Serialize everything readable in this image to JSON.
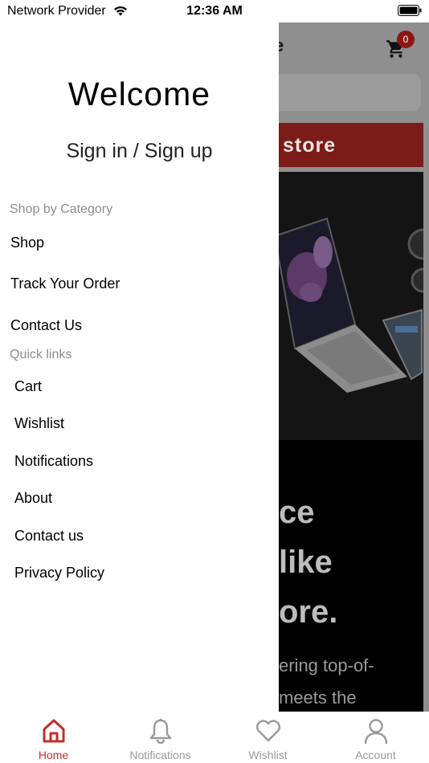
{
  "status_bar": {
    "carrier": "Network Provider",
    "time": "12:36 AM"
  },
  "background_page": {
    "header_title_fragment": "e",
    "cart_count": "0",
    "banner_text": "store",
    "hero_lines": [
      "ce",
      " like",
      "ore."
    ],
    "hero_sub_lines": [
      "ering top-of-",
      "meets the"
    ]
  },
  "drawer": {
    "welcome": "Welcome",
    "signin": "Sign in / Sign up",
    "sections": [
      {
        "title": "Shop by Category",
        "items": [
          "Shop",
          "Track Your Order",
          "Contact Us"
        ]
      },
      {
        "title": "Quick links",
        "items": [
          "Cart",
          "Wishlist",
          "Notifications",
          "About",
          "Contact us",
          "Privacy Policy"
        ]
      }
    ]
  },
  "tabbar": {
    "tabs": [
      {
        "label": "Home",
        "icon": "home-icon",
        "active": true
      },
      {
        "label": "Notifications",
        "icon": "bell-icon",
        "active": false
      },
      {
        "label": "Wishlist",
        "icon": "heart-icon",
        "active": false
      },
      {
        "label": "Account",
        "icon": "person-icon",
        "active": false
      }
    ]
  },
  "colors": {
    "accent": "#c0302b",
    "inactive": "#9a9a9a",
    "section_title": "#8c8c8c",
    "overlay": "#8f8f8f"
  }
}
